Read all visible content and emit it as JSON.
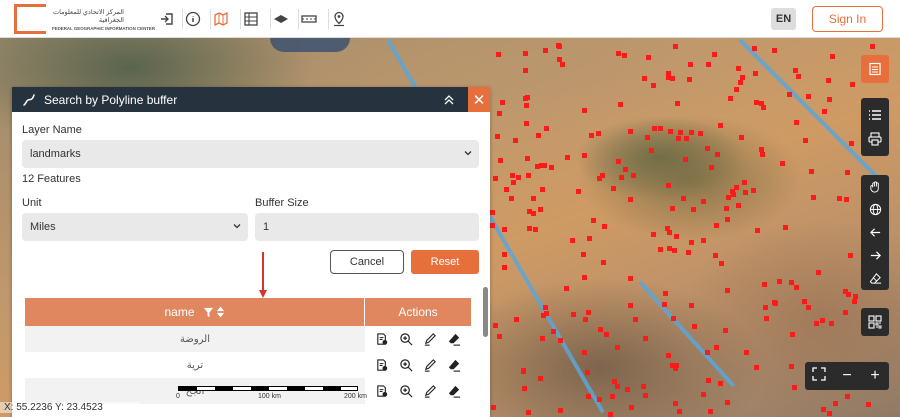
{
  "header": {
    "logo_ar": "المركز الاتحادي للمعلومات الجغرافية",
    "logo_en": "FEDERAL GEOGRAPHIC INFORMATION CENTER",
    "language": "EN",
    "sign_in": "Sign In",
    "tools": [
      "login-icon",
      "info-icon",
      "map-icon",
      "table-icon",
      "eye-icon",
      "road-icon",
      "location-icon"
    ]
  },
  "panel": {
    "title": "Search by Polyline buffer",
    "layer_label": "Layer Name",
    "layer_value": "landmarks",
    "features_count": "12 Features",
    "unit_label": "Unit",
    "unit_value": "Miles",
    "buffer_label": "Buffer Size",
    "buffer_value": "1",
    "cancel": "Cancel",
    "reset": "Reset",
    "table": {
      "col_name": "name",
      "col_actions": "Actions",
      "rows": [
        {
          "name": "الروضة"
        },
        {
          "name": "ترية"
        },
        {
          "name": "الجح"
        }
      ]
    }
  },
  "scale": {
    "labels": [
      "0",
      "100 km",
      "200 km"
    ]
  },
  "coords": "X: 55.2236   Y: 23.4523",
  "colors": {
    "accent": "#e76f3c",
    "panel_header": "#26333f",
    "table_header": "#e0875f",
    "points": "#ff1a1a"
  }
}
